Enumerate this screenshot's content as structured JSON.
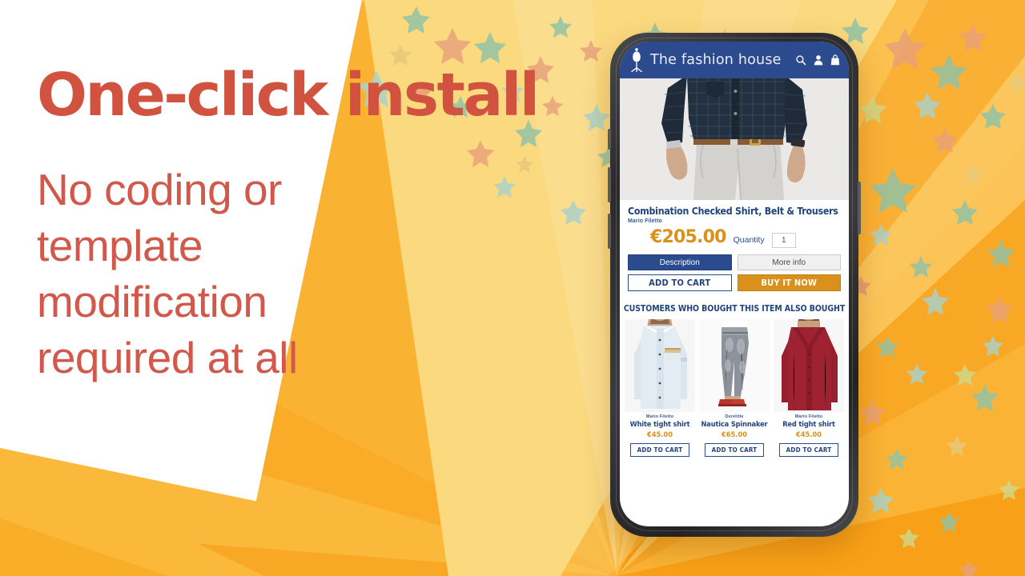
{
  "promo": {
    "headline": "One-click install",
    "subline": [
      "No coding or",
      "template",
      "modification",
      "required at all"
    ],
    "headline_color": "#d1523f",
    "subline_color": "#d1584a"
  },
  "background": {
    "base_color": "#ffffff",
    "light_wedge_color": "#fad97f",
    "ray_color_light": "#f9b83a",
    "ray_color_mid": "#f9a825",
    "ray_color_dark": "#f59300",
    "star_colors": [
      "#8fc3a8",
      "#e8a27a",
      "#a9d2cc",
      "#e8c97a",
      "#cfd98c",
      "#e0857a"
    ]
  },
  "phone": {
    "bezel_color": "#2b2b2d",
    "screen_background": "#ffffff"
  },
  "app": {
    "header": {
      "shop_name": "The fashion house",
      "header_color": "#2c4b8e",
      "logo_icon": "mannequin-icon",
      "icons": [
        "search-icon",
        "user-icon",
        "shopping-bag-icon"
      ]
    },
    "product": {
      "title": "Combination Checked Shirt, Belt & Trousers",
      "brand": "Mario Filetto",
      "price": "€205.00",
      "price_color": "#d9911c",
      "quantity_label": "Quantity",
      "quantity_value": "1",
      "image_alt": "man-wearing-navy-checked-shirt-brown-belt-grey-trousers"
    },
    "tabs": [
      {
        "label": "Description",
        "active": true
      },
      {
        "label": "More info",
        "active": false
      }
    ],
    "actions": {
      "add_to_cart": "ADD TO CART",
      "buy_it_now": "BUY IT NOW"
    },
    "related": {
      "heading": "CUSTOMERS WHO BOUGHT THIS ITEM ALSO BOUGHT",
      "add_to_cart_label": "ADD TO CART",
      "items": [
        {
          "brand": "Mario Filetto",
          "name": "White tight shirt",
          "price": "€45.00",
          "image_alt": "man-in-white-light-blue-shirt"
        },
        {
          "brand": "Derelitte",
          "name": "Nautica Spinnaker",
          "price": "€65.00",
          "image_alt": "grey-skinny-jeans-with-red-sneakers"
        },
        {
          "brand": "Mario Filetto",
          "name": "Red tight shirt",
          "price": "€45.00",
          "image_alt": "man-in-dark-red-shirt"
        }
      ]
    }
  }
}
